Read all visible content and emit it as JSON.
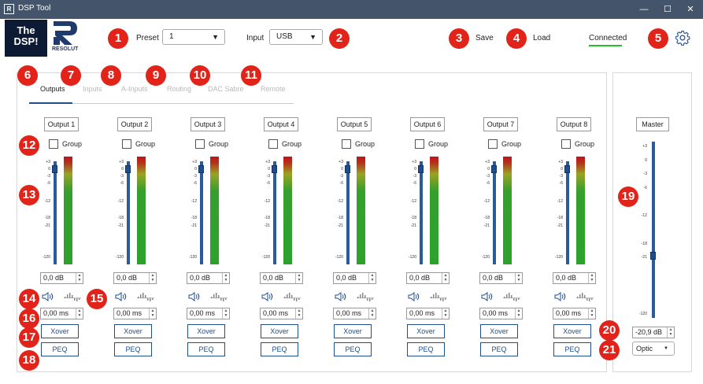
{
  "window": {
    "title": "DSP Tool",
    "app_icon": "R",
    "minimize": "—",
    "maximize": "☐",
    "close": "✕"
  },
  "logo": {
    "line1": "The",
    "line2": "DSP!",
    "brand": "RESOLUT"
  },
  "header": {
    "preset_label": "Preset",
    "preset_value": "1",
    "input_label": "Input",
    "input_value": "USB",
    "save_label": "Save",
    "load_label": "Load",
    "status": "Connected"
  },
  "tabs": [
    "Outputs",
    "Inputs",
    "A-Inputs",
    "Routing",
    "DAC Sabre",
    "Remote"
  ],
  "markers": [
    "1",
    "2",
    "3",
    "4",
    "5",
    "6",
    "7",
    "8",
    "9",
    "10",
    "11",
    "12",
    "13",
    "14",
    "15",
    "16",
    "17",
    "18",
    "19",
    "20",
    "21"
  ],
  "scale_labels": [
    "+3",
    "0",
    "-3",
    "-6",
    "-12",
    "-18",
    "-21",
    "-120"
  ],
  "outputs": [
    {
      "label": "Output 1",
      "group": "Group",
      "gain": "0,0 dB",
      "delay": "0,00 ms",
      "xover": "Xover",
      "peq": "PEQ"
    },
    {
      "label": "Output 2",
      "group": "Group",
      "gain": "0,0 dB",
      "delay": "0,00 ms",
      "xover": "Xover",
      "peq": "PEQ"
    },
    {
      "label": "Output 3",
      "group": "Group",
      "gain": "0,0 dB",
      "delay": "0,00 ms",
      "xover": "Xover",
      "peq": "PEQ"
    },
    {
      "label": "Output 4",
      "group": "Group",
      "gain": "0,0 dB",
      "delay": "0,00 ms",
      "xover": "Xover",
      "peq": "PEQ"
    },
    {
      "label": "Output 5",
      "group": "Group",
      "gain": "0,0 dB",
      "delay": "0,00 ms",
      "xover": "Xover",
      "peq": "PEQ"
    },
    {
      "label": "Output 6",
      "group": "Group",
      "gain": "0,0 dB",
      "delay": "0,00 ms",
      "xover": "Xover",
      "peq": "PEQ"
    },
    {
      "label": "Output 7",
      "group": "Group",
      "gain": "0,0 dB",
      "delay": "0,00 ms",
      "xover": "Xover",
      "peq": "PEQ"
    },
    {
      "label": "Output 8",
      "group": "Group",
      "gain": "0,0 dB",
      "delay": "0,00 ms",
      "xover": "Xover",
      "peq": "PEQ"
    }
  ],
  "master": {
    "label": "Master",
    "gain": "-20,9 dB",
    "source": "Optic"
  },
  "colors": {
    "accent": "#1f4e8c",
    "marker": "#e2231a",
    "connected": "#26c12a",
    "titlebar": "#44546b"
  }
}
